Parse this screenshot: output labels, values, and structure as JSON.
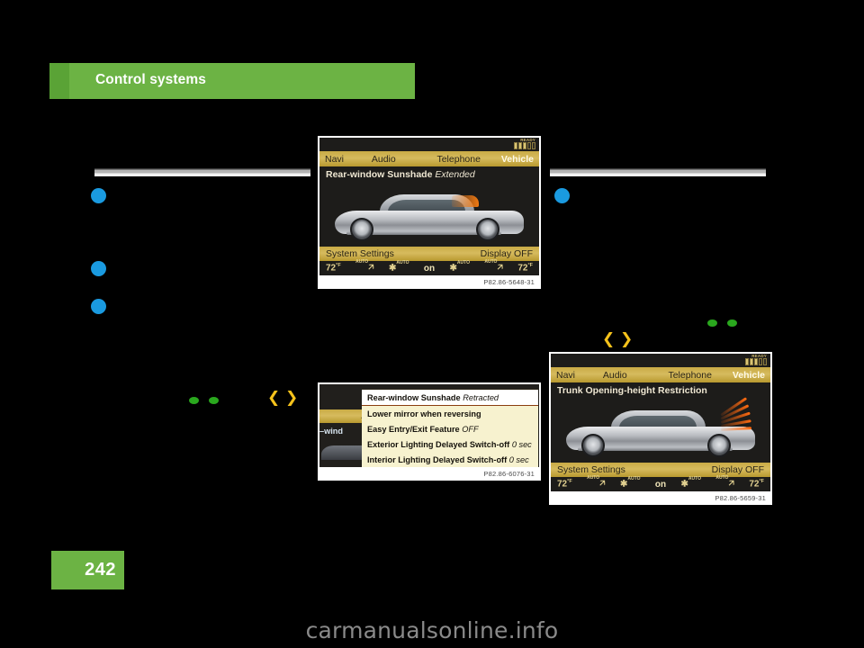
{
  "page": {
    "chapter_title": "Control systems",
    "page_number": "242",
    "watermark": "carmanualsonline.info",
    "accent_green": "#6cb344",
    "bullet_blue": "#1a9ae0",
    "marker_green": "#2aa81e",
    "marker_yellow": "#f5c21b"
  },
  "figures": [
    {
      "id": "fig-rear-window-sunshade-extended",
      "caption": "P82.86-5648-31",
      "status": {
        "ready_label": "READY",
        "signal_bars_on": 3,
        "signal_bars_off": 2
      },
      "menubar": {
        "navi": "Navi",
        "audio": "Audio",
        "telephone": "Telephone",
        "vehicle": "Vehicle"
      },
      "headline_label": "Rear-window Sunshade",
      "headline_value": "Extended",
      "settingsbar": {
        "system_settings": "System Settings",
        "display_off": "Display OFF"
      },
      "climate": {
        "temp_left": "72",
        "temp_left_unit": "°F",
        "auto_left": "AUTO",
        "fan_left": "AUTO",
        "center": "on",
        "fan_right": "AUTO",
        "auto_right": "AUTO",
        "temp_right": "72",
        "temp_right_unit": "°F"
      }
    },
    {
      "id": "fig-rear-window-sunshade-retracted-menu",
      "caption": "P82.86-6076-31",
      "behind": {
        "gold_fragment": "A",
        "text_fragment": "–wind"
      },
      "menu_items": [
        {
          "label": "Rear-window Sunshade",
          "value": "Retracted",
          "selected": true
        },
        {
          "label": "Lower mirror when reversing",
          "value": "",
          "selected": false
        },
        {
          "label": "Easy Entry/Exit Feature",
          "value": "OFF",
          "selected": false
        },
        {
          "label": "Exterior Lighting Delayed Switch-off",
          "value": "0 sec",
          "selected": false
        },
        {
          "label": "Interior Lighting Delayed Switch-off",
          "value": "0 sec",
          "selected": false
        }
      ]
    },
    {
      "id": "fig-trunk-opening-height-restriction",
      "caption": "P82.86-5659-31",
      "status": {
        "ready_label": "READY",
        "signal_bars_on": 3,
        "signal_bars_off": 2
      },
      "menubar": {
        "navi": "Navi",
        "audio": "Audio",
        "telephone": "Telephone",
        "vehicle": "Vehicle"
      },
      "headline_label": "Trunk Opening-height Restriction",
      "headline_value": "",
      "settingsbar": {
        "system_settings": "System Settings",
        "display_off": "Display OFF"
      },
      "climate": {
        "temp_left": "72",
        "temp_left_unit": "°F",
        "auto_left": "AUTO",
        "fan_left": "AUTO",
        "center": "on",
        "fan_right": "AUTO",
        "auto_right": "AUTO",
        "temp_right": "72",
        "temp_right_unit": "°F"
      }
    }
  ]
}
